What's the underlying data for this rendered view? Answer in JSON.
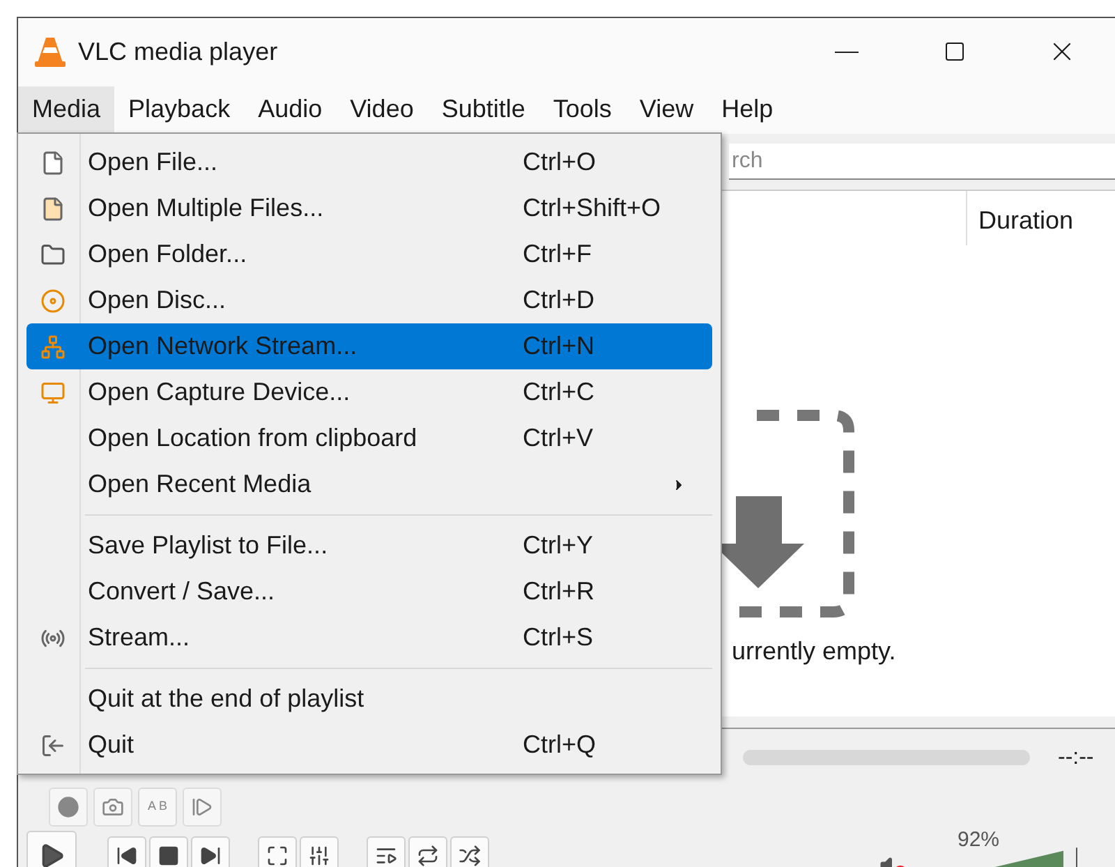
{
  "window": {
    "title": "VLC media player"
  },
  "menu_bar": [
    {
      "label": "Media",
      "selected": true
    },
    {
      "label": "Playback",
      "selected": false
    },
    {
      "label": "Audio",
      "selected": false
    },
    {
      "label": "Video",
      "selected": false
    },
    {
      "label": "Subtitle",
      "selected": false
    },
    {
      "label": "Tools",
      "selected": false
    },
    {
      "label": "View",
      "selected": false
    },
    {
      "label": "Help",
      "selected": false
    }
  ],
  "media_menu": [
    {
      "kind": "item",
      "label": "Open File...",
      "shortcut": "Ctrl+O",
      "selected": false
    },
    {
      "kind": "item",
      "label": "Open Multiple Files...",
      "shortcut": "Ctrl+Shift+O",
      "selected": false
    },
    {
      "kind": "item",
      "label": "Open Folder...",
      "shortcut": "Ctrl+F",
      "selected": false
    },
    {
      "kind": "item",
      "label": "Open Disc...",
      "shortcut": "Ctrl+D",
      "selected": false
    },
    {
      "kind": "item",
      "label": "Open Network Stream...",
      "shortcut": "Ctrl+N",
      "selected": true
    },
    {
      "kind": "item",
      "label": "Open Capture Device...",
      "shortcut": "Ctrl+C",
      "selected": false
    },
    {
      "kind": "item",
      "label": "Open Location from clipboard",
      "shortcut": "Ctrl+V",
      "selected": false
    },
    {
      "kind": "submenu",
      "label": "Open Recent Media",
      "selected": false
    },
    {
      "kind": "separator"
    },
    {
      "kind": "item",
      "label": "Save Playlist to File...",
      "shortcut": "Ctrl+Y",
      "selected": false
    },
    {
      "kind": "item",
      "label": "Convert / Save...",
      "shortcut": "Ctrl+R",
      "selected": false
    },
    {
      "kind": "item",
      "label": "Stream...",
      "shortcut": "Ctrl+S",
      "selected": false
    },
    {
      "kind": "separator"
    },
    {
      "kind": "item",
      "label": "Quit at the end of playlist",
      "selected": false
    },
    {
      "kind": "item",
      "label": "Quit",
      "shortcut": "Ctrl+Q",
      "selected": false
    }
  ],
  "search": {
    "placeholder": "rch"
  },
  "playlist": {
    "columns": [
      "Duration"
    ],
    "empty_message": "urrently empty."
  },
  "seek": {
    "time": "--:--"
  },
  "ab_loop_label": "A B",
  "volume": {
    "reading": "92%",
    "level": 0.92,
    "muted": true
  }
}
